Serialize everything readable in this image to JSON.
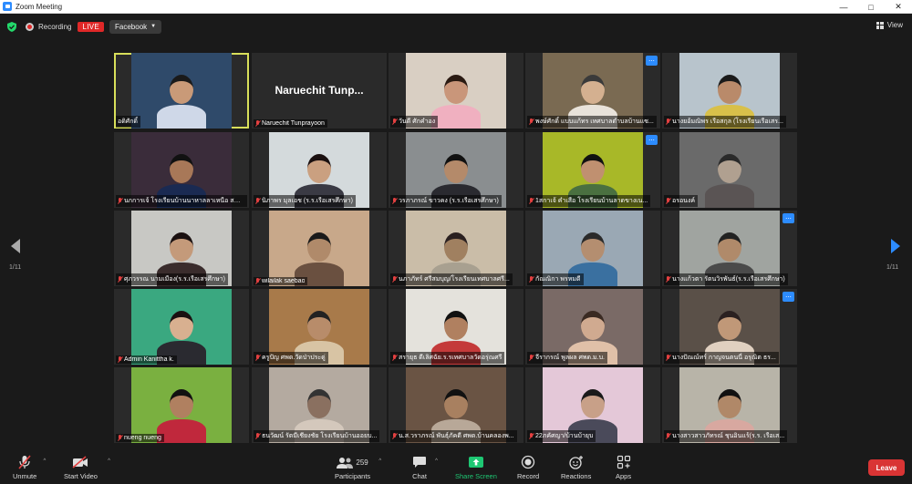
{
  "window": {
    "title": "Zoom Meeting"
  },
  "topbar": {
    "recording_label": "Recording",
    "live_badge": "LIVE",
    "stream_target": "Facebook",
    "view_label": "View"
  },
  "gallery": {
    "page_left": "1/11",
    "page_right": "1/11",
    "tiles": [
      {
        "name": "อดิศักดิ์",
        "muted": false,
        "active": true,
        "bg": "#2f4a6a",
        "person": "#cfd8e8",
        "skin": "#c99a78",
        "hair": "#1a1a1a"
      },
      {
        "name": "Naruechit Tunprayoon",
        "big": "Naruechit Tunp...",
        "muted": true,
        "bg": "#232323"
      },
      {
        "name": "วันดี ศักคำอง",
        "muted": true,
        "bg": "#d9cfc3",
        "person": "#f0b0c0",
        "skin": "#c9967a",
        "hair": "#2a1a12"
      },
      {
        "name": "พงษ์ศักดิ์ แบบแก้ทร เทศบาลตำบลบ้านแซ...",
        "muted": true,
        "more": true,
        "bg": "#7a6a52",
        "person": "#e8e2da",
        "skin": "#d4b090",
        "hair": "#3a3a3a"
      },
      {
        "name": "นางยอ้มณิพร เรือสกุล (โรงเรียนเรือเสร...",
        "muted": true,
        "bg": "#b8c4cc",
        "person": "#d8c04a",
        "skin": "#b98a6a",
        "hair": "#1a1a1a"
      },
      {
        "name": "นกการเจ้ โรงเรียนบ้านนาหาลลาเหนือ สพป...",
        "muted": true,
        "bg": "#3a2c3a",
        "person": "#1a2a52",
        "skin": "#a87858",
        "hair": "#111"
      },
      {
        "name": "นิภาพร มุลเอช (ร.ร.เรือเสรศึกษา)",
        "muted": true,
        "bg": "#d4dadc",
        "person": "#3a3a44",
        "skin": "#caa080",
        "hair": "#1a1010"
      },
      {
        "name": "วรภาภรณ์ ขาวคง (ร.ร.เรือเสรศึกษา)",
        "muted": true,
        "bg": "#8a8e90",
        "person": "#2a2a30",
        "skin": "#b48a6a",
        "hair": "#111"
      },
      {
        "name": "1สกาเจ้ คำเสือ โรงเรียนบ้านลาดขางเน...",
        "muted": true,
        "more": true,
        "bg": "#a8b828",
        "person": "#4a7040",
        "skin": "#c09070",
        "hair": "#111"
      },
      {
        "name": "อรอนงค์",
        "muted": true,
        "bg": "#6a6a6a",
        "person": "#5a5454",
        "skin": "#b0a090",
        "hair": "#2a2a2a"
      },
      {
        "name": "ศุภวรรณ นามเมือง(ร.ร.เรือเสรศึกษา)",
        "muted": true,
        "bg": "#c8c8c4",
        "person": "#3a2c2c",
        "skin": "#c49a7a",
        "hair": "#1a1010"
      },
      {
        "name": "wilailak saebao",
        "muted": true,
        "bg": "#c8a88a",
        "person": "#6a5040",
        "skin": "#b08a6a",
        "hair": "#1a1a1a"
      },
      {
        "name": "นภาภัทร์ ศรีสมบุญ/โรงเรียนเทศบาลศรี...",
        "muted": true,
        "bg": "#cabda8",
        "person": "#a8a090",
        "skin": "#a08060",
        "hair": "#2a2020"
      },
      {
        "name": "กัณณิกา พรหมดี",
        "muted": true,
        "bg": "#9aa8b4",
        "person": "#3a70a0",
        "skin": "#b48e70",
        "hair": "#2a2a2a"
      },
      {
        "name": "นางแก้วตา รัตนวิรพันธ์(ร.ร.เรือเสรศึกษา)",
        "muted": true,
        "more": true,
        "bg": "#a0a4a0",
        "person": "#4a4a4a",
        "skin": "#b08a6a",
        "hair": "#222"
      },
      {
        "name": "Admin Kanittha k.",
        "muted": true,
        "bg": "#3aa880",
        "person": "#2a2a30",
        "skin": "#d8b090",
        "hair": "#1a1010"
      },
      {
        "name": "ครูปัญ ศพด.วัดป่าประดู่",
        "muted": true,
        "bg": "#a87a4a",
        "person": "#d8c4a4",
        "skin": "#b88c6a",
        "hair": "#222"
      },
      {
        "name": "สรายุธ ดีเลิศฉัย.ร.รเทศบาลวัดอรุ่ณศรี",
        "muted": true,
        "bg": "#e4e2dc",
        "person": "#c43a3a",
        "skin": "#b08060",
        "hair": "#111"
      },
      {
        "name": "จีรากรณ์ พูลผล ศพด.ม.บ.",
        "muted": true,
        "bg": "#7a6a66",
        "person": "#e0c0a8",
        "skin": "#d0aa90",
        "hair": "#3a2a22"
      },
      {
        "name": "นางปัณณ์ทร์ กาญจนตนนี่ อรุณิต ธร...",
        "muted": true,
        "more": true,
        "bg": "#5a5048",
        "person": "#e0d0c0",
        "skin": "#c09878",
        "hair": "#2a2020"
      },
      {
        "name": "nueng nueng",
        "muted": true,
        "bg": "#7ab040",
        "person": "#c0283c",
        "skin": "#b08060",
        "hair": "#111"
      },
      {
        "name": "ธนวัฒน์ รัตมีเชียงชัย โรงเรียนบ้านออยบ...",
        "muted": true,
        "bg": "#b4aaa0",
        "person": "#d4c8bc",
        "skin": "#8a7060",
        "hair": "#333"
      },
      {
        "name": "น.ส.วราภรณ์ พันธุ์ภัคดี ศพด.บ้านคลองพ...",
        "muted": true,
        "bg": "#6a5444",
        "person": "#b8a898",
        "skin": "#a88060",
        "hair": "#111"
      },
      {
        "name": "22ภคัศญา/บ้านบ้ายุบ",
        "muted": true,
        "bg": "#e4c8d8",
        "person": "#4a4a5a",
        "skin": "#c8a088",
        "hair": "#1a1a1a"
      },
      {
        "name": "นางสาวสาวภัทรณ์ ชุนอินแร้(ร.ร. เรือเส...",
        "muted": true,
        "bg": "#b8b4a8",
        "person": "#d8a8a0",
        "skin": "#b08868",
        "hair": "#111"
      }
    ]
  },
  "toolbar": {
    "unmute": "Unmute",
    "start_video": "Start Video",
    "participants": "Participants",
    "participant_count": "259",
    "chat": "Chat",
    "share_screen": "Share Screen",
    "record": "Record",
    "reactions": "Reactions",
    "apps": "Apps",
    "leave": "Leave"
  },
  "colors": {
    "accent": "#2d8cff",
    "live": "#e02828",
    "share": "#1ec773",
    "active_speaker": "#d8df5a",
    "leave": "#d93434"
  }
}
